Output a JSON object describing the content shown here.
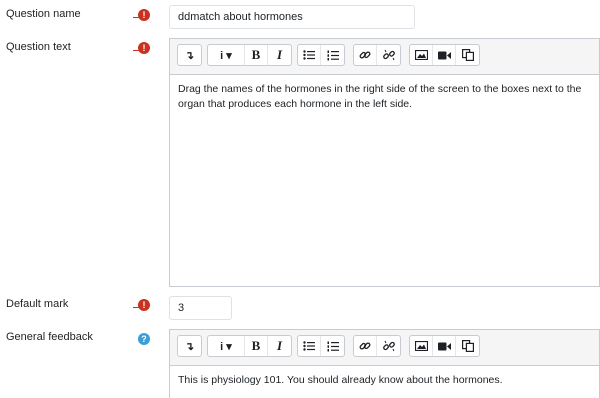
{
  "fields": {
    "question_name": {
      "label": "Question name",
      "value": "ddmatch about hormones"
    },
    "question_text": {
      "label": "Question text",
      "content": "Drag the names of the hormones in the right side of the screen to the boxes next to the organ that produces each hormone in the left side."
    },
    "default_mark": {
      "label": "Default mark",
      "value": "3"
    },
    "general_feedback": {
      "label": "General feedback",
      "content": "This is physiology 101. You should already know about the hormones."
    }
  },
  "icons": {
    "required": "exclamation-circle-icon",
    "help": "question-circle-icon",
    "required_glyph": "!",
    "help_glyph": "?"
  },
  "toolbar": {
    "buttons": [
      "toggle",
      "info",
      "bold",
      "italic",
      "unordered-list",
      "ordered-list",
      "link",
      "unlink",
      "image",
      "media",
      "copy"
    ],
    "glyphs": {
      "toggle": "↴",
      "info": "i ▾",
      "bold": "B",
      "italic": "I"
    }
  },
  "colors": {
    "required": "#ca3120",
    "help": "#3b9fd6",
    "border": "#c6ccd2"
  }
}
